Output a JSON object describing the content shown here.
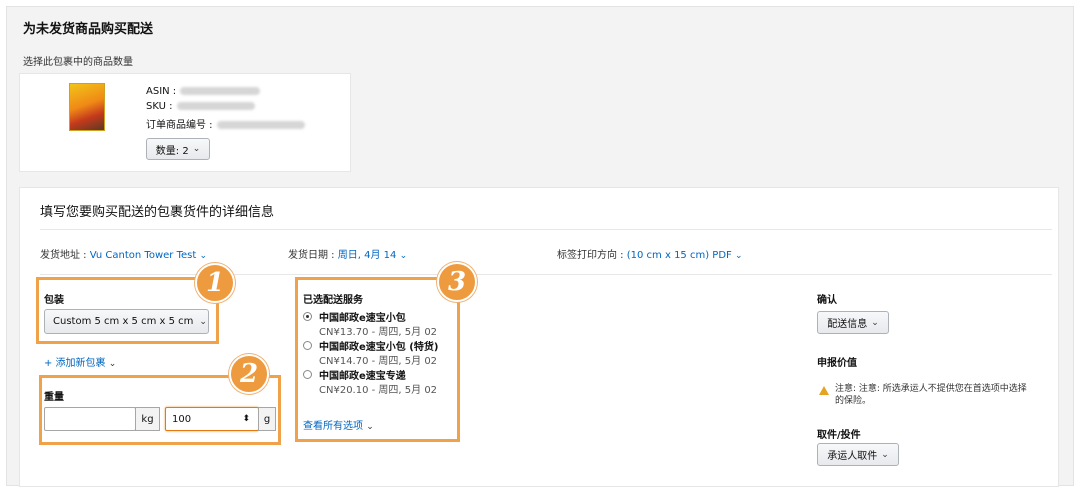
{
  "page": {
    "title": "为未发货商品购买配送",
    "qty_note": "选择此包裹中的商品数量"
  },
  "product": {
    "thumb_icon": "book-cover-thumbnail",
    "asin_label": "ASIN :",
    "sku_label": "SKU :",
    "order_item_label": "订单商品编号 :",
    "quantity_button": "数量: 2"
  },
  "details": {
    "title": "填写您要购买配送的包裹货件的详细信息",
    "ship_from_label": "发货地址 :",
    "ship_from_value": "Vu Canton Tower Test",
    "ship_date_label": "发货日期 :",
    "ship_date_value": "周日, 4月 14",
    "label_orient_label": "标签打印方向 :",
    "label_orient_value": "(10 cm x 15 cm) PDF"
  },
  "package": {
    "label": "包装",
    "selected": "Custom 5 cm x 5 cm x 5 cm",
    "add_link": "+ 添加新包裹"
  },
  "weight": {
    "label": "重量",
    "kg_value": "",
    "kg_unit": "kg",
    "g_value": "100",
    "g_unit": "g"
  },
  "services": {
    "label": "已选配送服务",
    "options": [
      {
        "name": "中国邮政e速宝小包",
        "price": "CN¥13.70 - 周四, 5月 02",
        "selected": true
      },
      {
        "name": "中国邮政e速宝小包 (特货)",
        "price": "CN¥14.70 - 周四, 5月 02",
        "selected": false
      },
      {
        "name": "中国邮政e速宝专递",
        "price": "CN¥20.10 - 周四, 5月 02",
        "selected": false
      }
    ],
    "view_all": "查看所有选项"
  },
  "confirm": {
    "label": "确认",
    "button": "配送信息"
  },
  "declared": {
    "label": "申报价值",
    "note_line1": "注意: 注意: 所选承运人不提供您在首选项中选择",
    "note_line2": "的保险。"
  },
  "pickup": {
    "label": "取件/投件",
    "button": "承运人取件"
  },
  "badges": [
    "1",
    "2",
    "3"
  ],
  "colors": {
    "highlight": "#f0a24a",
    "link": "#0066c0",
    "warning": "#e5a320"
  }
}
